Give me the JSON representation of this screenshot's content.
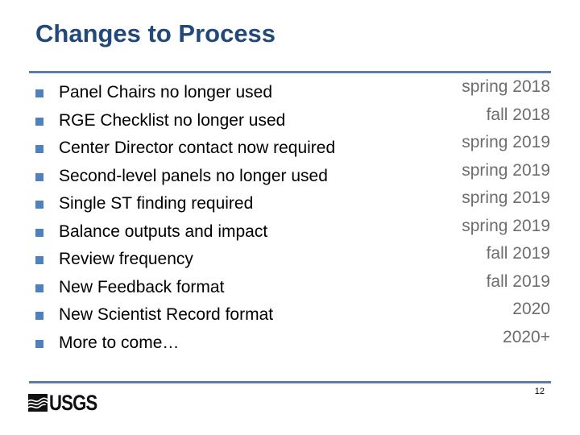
{
  "slide": {
    "title": "Changes to Process",
    "page_number": "12",
    "brand": {
      "logo_text": "USGS",
      "logo_icon": "usgs-waves-icon",
      "title_color": "#23487a",
      "rule_color": "#5a7ea8",
      "bullet_color": "#4f81bd",
      "date_color": "#6d6d6d"
    }
  },
  "changes": [
    {
      "item": "Panel Chairs no longer used",
      "when": "spring 2018"
    },
    {
      "item": "RGE Checklist no longer used",
      "when": "fall 2018"
    },
    {
      "item": "Center Director contact now required",
      "when": "spring 2019"
    },
    {
      "item": "Second-level panels no longer used",
      "when": "spring 2019"
    },
    {
      "item": "Single ST finding required",
      "when": "spring 2019"
    },
    {
      "item": "Balance outputs and impact",
      "when": "spring 2019"
    },
    {
      "item": "Review frequency",
      "when": "fall 2019"
    },
    {
      "item": "New Feedback format",
      "when": "fall 2019"
    },
    {
      "item": "New Scientist Record format",
      "when": "2020"
    },
    {
      "item": "More to come…",
      "when": "2020+"
    }
  ]
}
